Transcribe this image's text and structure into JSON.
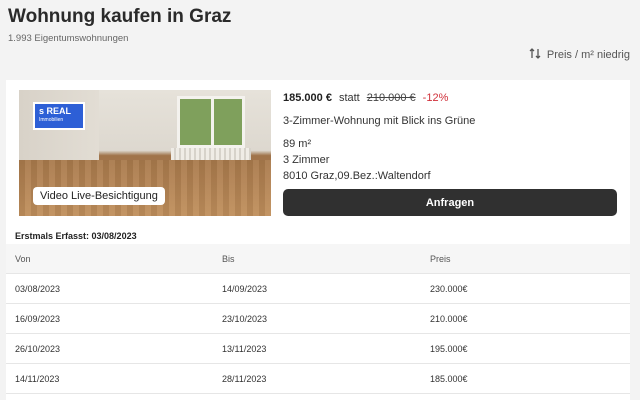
{
  "header": {
    "title": "Wohnung kaufen in Graz",
    "subtitle": "1.993 Eigentumswohnungen",
    "sort_label": "Preis / m² niedrig",
    "sort_icon": "sort-arrows-icon"
  },
  "listing": {
    "badge_line1": "s REAL",
    "badge_line2": "Immobilien",
    "video_label": "Video Live-Besichtigung",
    "price": "185.000 €",
    "statt": "statt",
    "old_price": "210.000 €",
    "discount": "-12%",
    "description": "3-Zimmer-Wohnung mit Blick ins Grüne",
    "area": "89 m²",
    "rooms": "3 Zimmer",
    "location": "8010 Graz,09.Bez.:Waltendorf",
    "cta_label": "Anfragen",
    "discount_color": "#d0303a",
    "badge_color": "#2d5fd6"
  },
  "history": {
    "first_recorded": "Erstmals Erfasst: 03/08/2023",
    "columns": [
      "Von",
      "Bis",
      "Preis"
    ],
    "rows": [
      [
        "03/08/2023",
        "14/09/2023",
        "230.000€"
      ],
      [
        "16/09/2023",
        "23/10/2023",
        "210.000€"
      ],
      [
        "26/10/2023",
        "13/11/2023",
        "195.000€"
      ],
      [
        "14/11/2023",
        "28/11/2023",
        "185.000€"
      ]
    ]
  }
}
